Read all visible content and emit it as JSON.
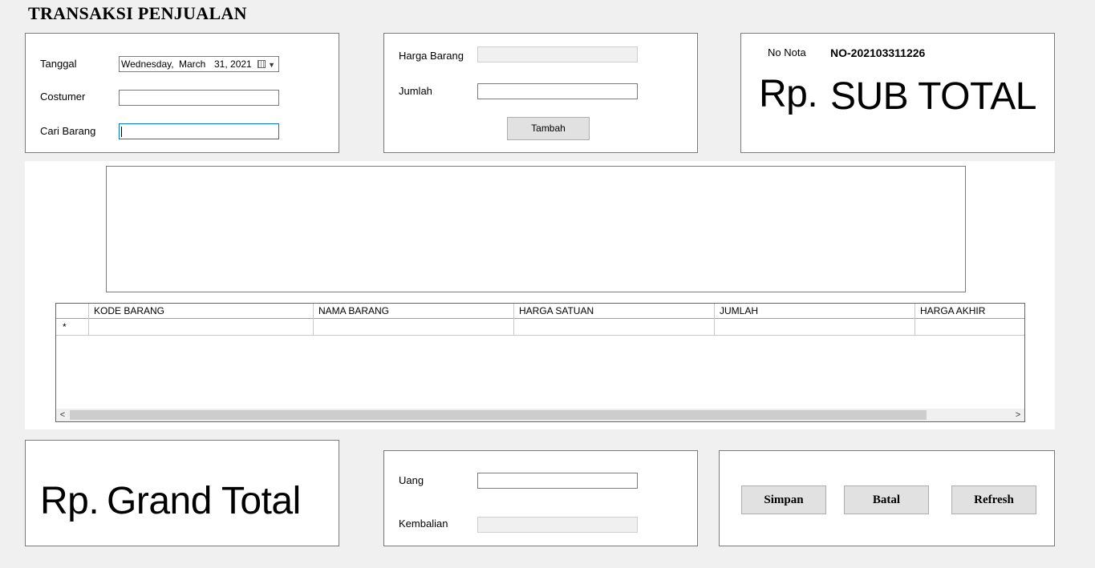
{
  "title": "TRANSAKSI PENJUALAN",
  "form_left": {
    "tanggal_label": "Tanggal",
    "date": {
      "weekday": "Wednesday,",
      "month": "March",
      "day_year": "31, 2021"
    },
    "costumer_label": "Costumer",
    "costumer_value": "",
    "cari_barang_label": "Cari Barang",
    "cari_barang_value": ""
  },
  "form_mid": {
    "harga_barang_label": "Harga Barang",
    "harga_barang_value": "",
    "jumlah_label": "Jumlah",
    "jumlah_value": "",
    "tambah_button": "Tambah"
  },
  "nota": {
    "label": "No Nota",
    "value": "NO-202103311226",
    "rp": "Rp.",
    "sub_total": "SUB TOTAL"
  },
  "table": {
    "columns": [
      "KODE BARANG",
      "NAMA BARANG",
      "HARGA SATUAN",
      "JUMLAH",
      "HARGA AKHIR"
    ],
    "new_row_marker": "*",
    "scroll_left": "<",
    "scroll_right": ">"
  },
  "grand": {
    "rp": "Rp.",
    "label": "Grand Total"
  },
  "payment": {
    "uang_label": "Uang",
    "uang_value": "",
    "kembalian_label": "Kembalian",
    "kembalian_value": ""
  },
  "actions": {
    "simpan": "Simpan",
    "batal": "Batal",
    "refresh": "Refresh"
  },
  "colors": {
    "background": "#f0f0f0",
    "panel": "#ffffff",
    "button": "#e1e1e1",
    "focus": "#0078d7"
  }
}
